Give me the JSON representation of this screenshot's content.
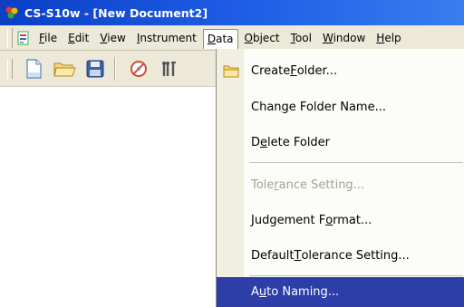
{
  "window": {
    "title": "CS-S10w - [New Document2]"
  },
  "menubar": {
    "items": [
      {
        "pre": "",
        "acc": "F",
        "post": "ile"
      },
      {
        "pre": "",
        "acc": "E",
        "post": "dit"
      },
      {
        "pre": "",
        "acc": "V",
        "post": "iew"
      },
      {
        "pre": "",
        "acc": "I",
        "post": "nstrument"
      },
      {
        "pre": "",
        "acc": "D",
        "post": "ata"
      },
      {
        "pre": "",
        "acc": "O",
        "post": "bject"
      },
      {
        "pre": "",
        "acc": "T",
        "post": "ool"
      },
      {
        "pre": "",
        "acc": "W",
        "post": "indow"
      },
      {
        "pre": "",
        "acc": "H",
        "post": "elp"
      }
    ]
  },
  "toolbar": {
    "icons": [
      "new-document-icon",
      "open-folder-icon",
      "save-disk-icon",
      "measure-target-icon",
      "calibration-tool-icon"
    ]
  },
  "data_menu": {
    "items": [
      {
        "pre": "Create ",
        "acc": "F",
        "post": "older...",
        "enabled": true,
        "icon": "folder-icon"
      },
      {
        "pre": "Chan",
        "acc": "g",
        "post": "e Folder Name...",
        "enabled": true
      },
      {
        "pre": "D",
        "acc": "e",
        "post": "lete Folder",
        "enabled": true
      },
      {
        "pre": "Tole",
        "acc": "r",
        "post": "ance Setting...",
        "enabled": false
      },
      {
        "pre": "Judgement F",
        "acc": "o",
        "post": "rmat...",
        "enabled": true
      },
      {
        "pre": "Default ",
        "acc": "T",
        "post": "olerance Setting...",
        "enabled": true
      },
      {
        "pre": "A",
        "acc": "u",
        "post": "to Naming...",
        "enabled": true,
        "highlighted": true
      }
    ]
  },
  "colors": {
    "titlebar": "#0a3fc6",
    "highlight": "#2d3ea8",
    "menu_bg": "#ece9d8",
    "disabled_text": "#a6a38f"
  }
}
